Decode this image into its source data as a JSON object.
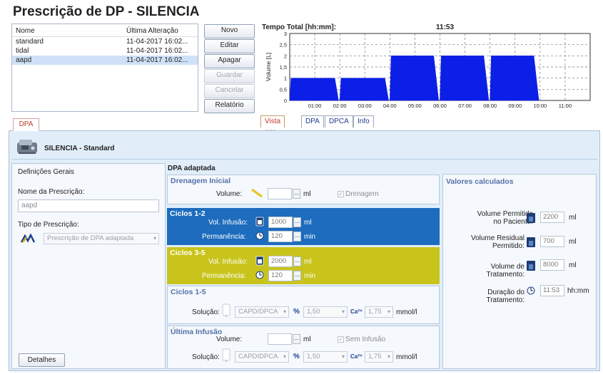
{
  "window": {
    "title": "Prescrição de DP - SILENCIA"
  },
  "prescriptions": {
    "headers": {
      "name": "Nome",
      "modified": "Última Alteração"
    },
    "rows": [
      {
        "name": "standard",
        "modified": "11-04-2017 16:02..."
      },
      {
        "name": "tidal",
        "modified": "11-04-2017 16:02..."
      },
      {
        "name": "aapd",
        "modified": "11-04-2017 16:02..."
      }
    ],
    "selected_index": 2
  },
  "actions": {
    "novo": "Novo",
    "editar": "Editar",
    "apagar": "Apagar",
    "guardar": "Guardar",
    "cancelar": "Cancelar",
    "relatorio": "Relatório"
  },
  "chart_header": {
    "label": "Tempo Total [hh:mm]:",
    "value": "11:53"
  },
  "chart_data": {
    "type": "area",
    "ylabel": "Volume [L]",
    "ylim": [
      0,
      3
    ],
    "yticks": [
      "0",
      "0,5",
      "1",
      "1,5",
      "2",
      "2,5",
      "3"
    ],
    "xticks": [
      "01:00",
      "02:00",
      "03:00",
      "04:00",
      "05:00",
      "06:00",
      "07:00",
      "08:00",
      "09:00",
      "10:00",
      "11:00"
    ],
    "x_hours": [
      0.0,
      0.1,
      1.9,
      2.1,
      3.9,
      4.1,
      5.9,
      6.1,
      7.9,
      8.1,
      9.9,
      10.1,
      11.7,
      11.88
    ],
    "y_liters": [
      0,
      1,
      1,
      0,
      1,
      0,
      2,
      2,
      0,
      2,
      2,
      0,
      2,
      0
    ],
    "segments": [
      {
        "start": 0.0,
        "end": 1.95,
        "peak": 1,
        "ramp_out": 0.15
      },
      {
        "start": 2.0,
        "end": 3.95,
        "peak": 1,
        "ramp_out": 0.15
      },
      {
        "start": 4.0,
        "end": 5.95,
        "peak": 2,
        "ramp_out": 0.2
      },
      {
        "start": 6.0,
        "end": 7.95,
        "peak": 2,
        "ramp_out": 0.2
      },
      {
        "start": 8.0,
        "end": 9.95,
        "peak": 2,
        "ramp_out": 0.2
      }
    ],
    "x_range": [
      0,
      12
    ],
    "grid": true,
    "color": "#0b1fe6"
  },
  "chart_tabs": [
    "Vista ger.",
    "DPA",
    "DPCA",
    "Info"
  ],
  "main_tab": "DPA",
  "device": {
    "name": "SILENCIA - Standard"
  },
  "general": {
    "title": "Definições Gerais",
    "name_label": "Nome da Prescrição:",
    "name_value": "aapd",
    "type_label": "Tipo de Prescrição:",
    "type_value": "Prescrição de DPA adaptada",
    "details": "Detalhes"
  },
  "adapted": {
    "title": "DPA adaptada",
    "initial_drain": {
      "title": "Drenagem Inicial",
      "volume_label": "Volume:",
      "volume_value": "",
      "unit": "ml",
      "checkbox_label": "Drenagem"
    },
    "cycles12": {
      "title": "Ciclos 1-2",
      "infusion_label": "Vol. Infusão:",
      "infusion_value": "1000",
      "infusion_unit": "ml",
      "dwell_label": "Permanência:",
      "dwell_value": "120",
      "dwell_unit": "min"
    },
    "cycles35": {
      "title": "Ciclos 3-5",
      "infusion_label": "Vol. Infusão:",
      "infusion_value": "2000",
      "infusion_unit": "ml",
      "dwell_label": "Permanência:",
      "dwell_value": "120",
      "dwell_unit": "min"
    },
    "cycles15": {
      "title": "Ciclos 1-5",
      "solution_label": "Solução:",
      "solution": "CAPD/DPCA",
      "pct": "%",
      "glucose": "1,50",
      "ca_label": "Ca²⁺",
      "ca_value": "1,75",
      "ca_unit": "mmol/l"
    },
    "last_fill": {
      "title": "Última Infusão",
      "volume_label": "Volume:",
      "volume_value": "",
      "unit": "ml",
      "checkbox_label": "Sem Infusão",
      "solution_label": "Solução:",
      "solution": "CAPDIDPCA",
      "pct": "%",
      "glucose": "1,50",
      "ca_label": "Ca²⁺",
      "ca_value": "1,75",
      "ca_unit": "mmol/l"
    }
  },
  "calculated": {
    "title": "Valores calculados",
    "patient_volume": {
      "label1": "Volume Permitido",
      "label2": "no Paciente:",
      "value": "2200",
      "unit": "ml"
    },
    "residual_volume": {
      "label1": "Volume Residual",
      "label2": "Permitido:",
      "value": "700",
      "unit": "ml"
    },
    "treatment_volume": {
      "label1": "Volume de",
      "label2": "Tratamento:",
      "value": "8000",
      "unit": "ml"
    },
    "treatment_duration": {
      "label1": "Duração do",
      "label2": "Tratamento:",
      "value": "11:53",
      "unit": "hh:mm"
    }
  }
}
